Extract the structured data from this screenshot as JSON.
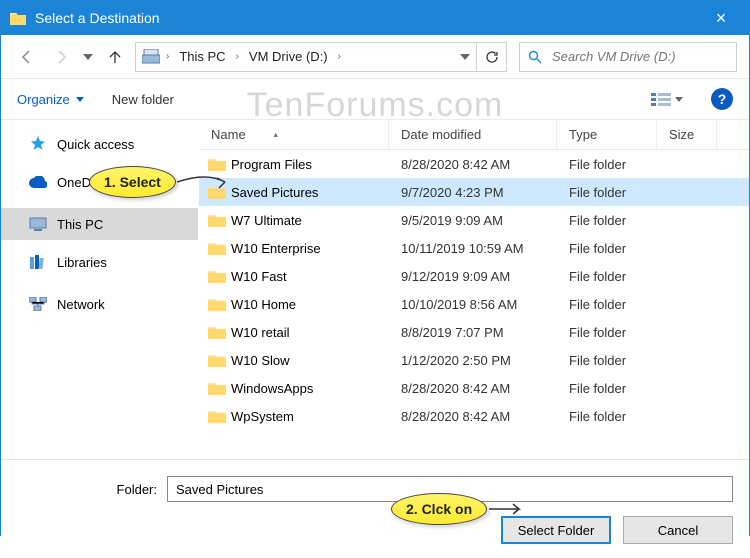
{
  "window": {
    "title": "Select a Destination",
    "close": "×"
  },
  "nav": {
    "breadcrumbs": [
      "This PC",
      "VM Drive (D:)"
    ],
    "search_placeholder": "Search VM Drive (D:)"
  },
  "toolbar": {
    "organize": "Organize",
    "new_folder": "New folder",
    "help": "?"
  },
  "sidebar": {
    "items": [
      {
        "label": "Quick access",
        "icon": "star"
      },
      {
        "label": "OneDrive",
        "icon": "cloud"
      },
      {
        "label": "This PC",
        "icon": "pc",
        "selected": true
      },
      {
        "label": "Libraries",
        "icon": "lib"
      },
      {
        "label": "Network",
        "icon": "net"
      }
    ]
  },
  "columns": {
    "name": "Name",
    "date": "Date modified",
    "type": "Type",
    "size": "Size"
  },
  "files": [
    {
      "name": "Program Files",
      "date": "8/28/2020 8:42 AM",
      "type": "File folder"
    },
    {
      "name": "Saved Pictures",
      "date": "9/7/2020 4:23 PM",
      "type": "File folder",
      "selected": true
    },
    {
      "name": "W7 Ultimate",
      "date": "9/5/2019 9:09 AM",
      "type": "File folder"
    },
    {
      "name": "W10 Enterprise",
      "date": "10/11/2019 10:59 AM",
      "type": "File folder"
    },
    {
      "name": "W10 Fast",
      "date": "9/12/2019 9:09 AM",
      "type": "File folder"
    },
    {
      "name": "W10 Home",
      "date": "10/10/2019 8:56 AM",
      "type": "File folder"
    },
    {
      "name": "W10 retail",
      "date": "8/8/2019 7:07 PM",
      "type": "File folder"
    },
    {
      "name": "W10 Slow",
      "date": "1/12/2020 2:50 PM",
      "type": "File folder"
    },
    {
      "name": "WindowsApps",
      "date": "8/28/2020 8:42 AM",
      "type": "File folder"
    },
    {
      "name": "WpSystem",
      "date": "8/28/2020 8:42 AM",
      "type": "File folder"
    }
  ],
  "folder_field": {
    "label": "Folder:",
    "value": "Saved Pictures"
  },
  "buttons": {
    "select": "Select Folder",
    "cancel": "Cancel"
  },
  "callouts": {
    "c1": "1. Select",
    "c2": "2. Clck on"
  },
  "watermark": "TenForums.com"
}
